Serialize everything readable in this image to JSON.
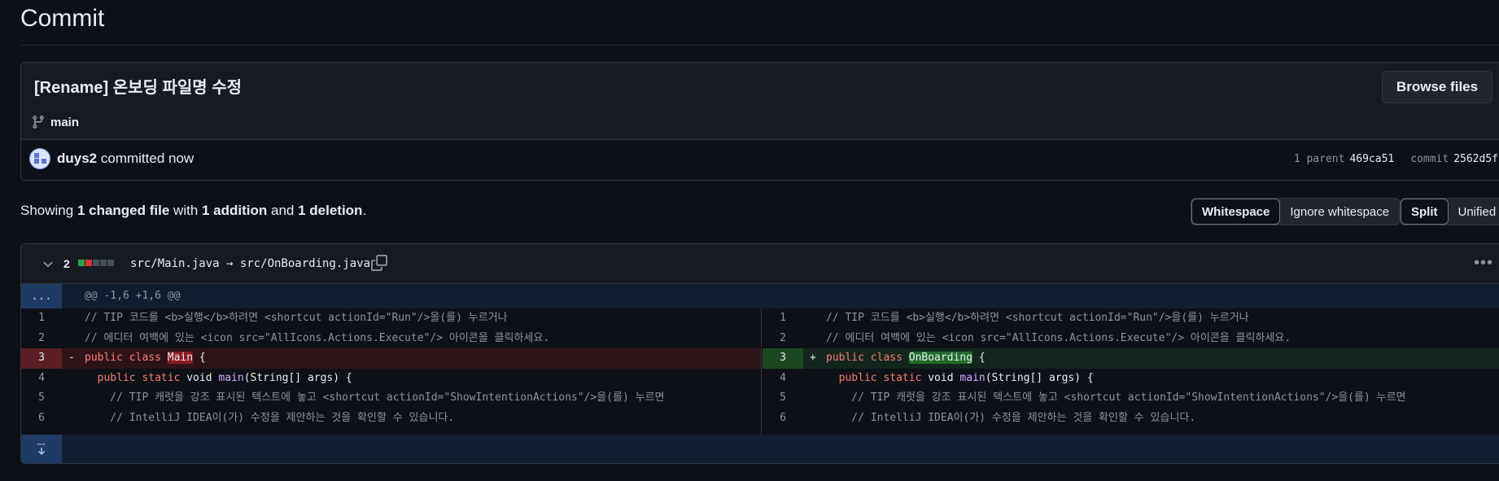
{
  "page": {
    "title": "Commit"
  },
  "commit": {
    "message": "[Rename] 온보딩 파일명 수정",
    "branch": "main",
    "browse_label": "Browse files",
    "author": "duys2",
    "committed_text": "committed now",
    "parent_label": "1 parent",
    "parent_sha": "469ca51",
    "commit_label": "commit",
    "commit_sha": "2562d5f"
  },
  "summary": {
    "showing": "Showing ",
    "changed": "1 changed file",
    "with": " with ",
    "additions": "1 addition",
    "and": " and ",
    "deletions": "1 deletion",
    "period": "."
  },
  "view_options": {
    "whitespace": "Whitespace",
    "ignore_whitespace": "Ignore whitespace",
    "split": "Split",
    "unified": "Unified"
  },
  "file": {
    "change_count": "2",
    "path": "src/Main.java → src/OnBoarding.java",
    "hunk_header": "@@ -1,6 +1,6 @@",
    "expand_label": "...",
    "left_lines": [
      {
        "num": "1",
        "text": "// TIP 코드를 <b>실행</b>하려면 <shortcut actionId=\"Run\"/>을(를) 누르거나"
      },
      {
        "num": "2",
        "text": "// 에디터 여백에 있는 <icon src=\"AllIcons.Actions.Execute\"/> 아이콘을 클릭하세요."
      },
      {
        "num": "3",
        "sign": "-",
        "kw": "public class ",
        "name": "Main",
        "tail": " {"
      },
      {
        "num": "4",
        "kw": "  public static ",
        "plain": "void ",
        "fn": "main",
        "tail": "(String[] args) {"
      },
      {
        "num": "5",
        "text": "    // TIP 캐럿을 강조 표시된 텍스트에 놓고 <shortcut actionId=\"ShowIntentionActions\"/>을(를) 누르면"
      },
      {
        "num": "6",
        "text": "    // IntelliJ IDEA이(가) 수정을 제안하는 것을 확인할 수 있습니다."
      }
    ],
    "right_lines": [
      {
        "num": "1",
        "text": "// TIP 코드를 <b>실행</b>하려면 <shortcut actionId=\"Run\"/>을(를) 누르거나"
      },
      {
        "num": "2",
        "text": "// 에디터 여백에 있는 <icon src=\"AllIcons.Actions.Execute\"/> 아이콘을 클릭하세요."
      },
      {
        "num": "3",
        "sign": "+",
        "kw": "public class ",
        "name": "OnBoarding",
        "tail": " {"
      },
      {
        "num": "4",
        "kw": "  public static ",
        "plain": "void ",
        "fn": "main",
        "tail": "(String[] args) {"
      },
      {
        "num": "5",
        "text": "    // TIP 캐럿을 강조 표시된 텍스트에 놓고 <shortcut actionId=\"ShowIntentionActions\"/>을(를) 누르면"
      },
      {
        "num": "6",
        "text": "    // IntelliJ IDEA이(가) 수정을 제안하는 것을 확인할 수 있습니다."
      }
    ]
  },
  "colors": {
    "background": "#0d1117",
    "deletion": "#5b1f24",
    "addition": "#1b4721",
    "hunk": "#121d2f"
  }
}
